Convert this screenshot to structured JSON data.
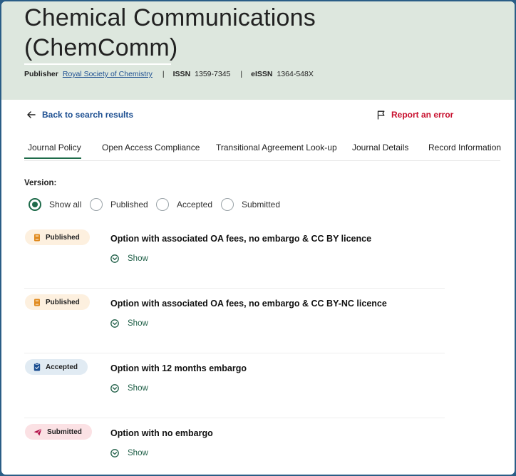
{
  "journal": {
    "title": "Chemical Communications (ChemComm)",
    "publisher_label": "Publisher",
    "publisher_name": "Royal Society of Chemistry",
    "issn_label": "ISSN",
    "issn": "1359-7345",
    "eissn_label": "eISSN",
    "eissn": "1364-548X",
    "separator": "|"
  },
  "nav": {
    "back_label": "Back to search results",
    "report_label": "Report an error"
  },
  "tabs": [
    {
      "label": "Journal Policy",
      "active": true
    },
    {
      "label": "Open Access Compliance",
      "active": false
    },
    {
      "label": "Transitional Agreement Look-up",
      "active": false
    },
    {
      "label": "Journal Details",
      "active": false
    },
    {
      "label": "Record Information",
      "active": false
    }
  ],
  "version": {
    "label": "Version:",
    "options": [
      {
        "label": "Show all",
        "checked": true
      },
      {
        "label": "Published",
        "checked": false
      },
      {
        "label": "Accepted",
        "checked": false
      },
      {
        "label": "Submitted",
        "checked": false
      }
    ]
  },
  "options": [
    {
      "badge": "Published",
      "badge_type": "published",
      "icon": "book-icon",
      "title": "Option with associated OA fees, no embargo & CC BY licence",
      "show_label": "Show"
    },
    {
      "badge": "Published",
      "badge_type": "published",
      "icon": "book-icon",
      "title": "Option with associated OA fees, no embargo & CC BY-NC licence",
      "show_label": "Show"
    },
    {
      "badge": "Accepted",
      "badge_type": "accepted",
      "icon": "clipboard-check-icon",
      "title": "Option with 12 months embargo",
      "show_label": "Show"
    },
    {
      "badge": "Submitted",
      "badge_type": "submitted",
      "icon": "paper-plane-icon",
      "title": "Option with no embargo",
      "show_label": "Show"
    }
  ],
  "colors": {
    "header_bg": "#dde7de",
    "accent_green": "#1e6b4a",
    "link_blue": "#1d4f91",
    "error_red": "#c8102e",
    "published_badge": "#fdf0df",
    "accepted_badge": "#e1ebf3",
    "submitted_badge": "#fbe1e4"
  }
}
